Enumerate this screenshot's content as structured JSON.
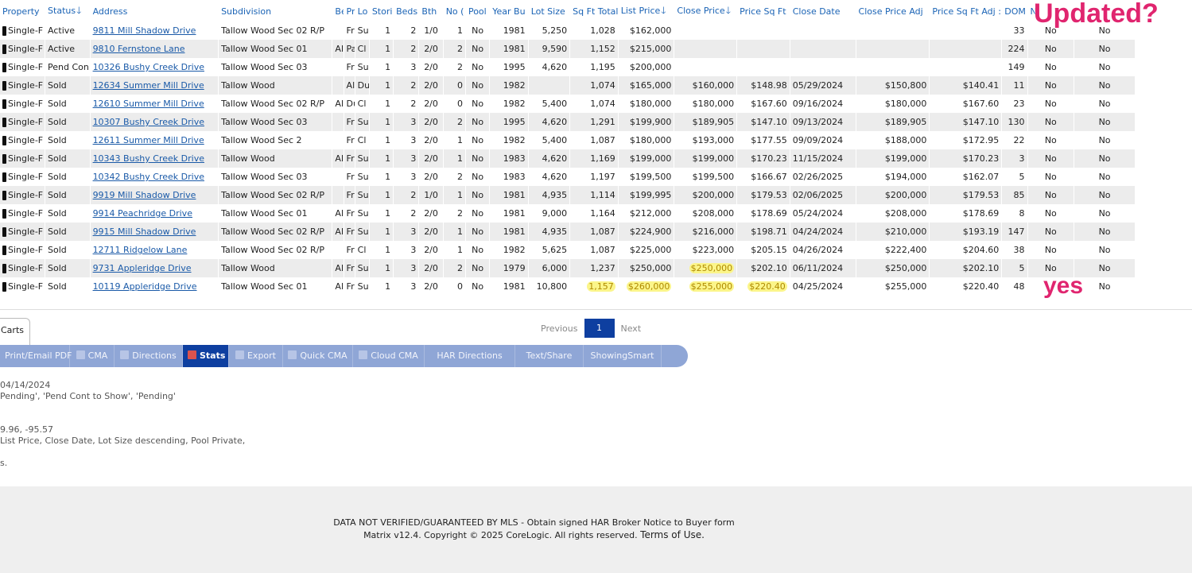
{
  "columns": [
    "Property",
    "Status",
    "Address",
    "Subdivision",
    "Be",
    "Pr",
    "Lo",
    "Stori",
    "Beds",
    "Bth",
    "No (",
    "Pool",
    "Year Bu",
    "Lot Size",
    "Sq Ft Total",
    "List Price",
    "Close Price",
    "Price Sq Ft",
    "Close Date",
    "Close Price Adj",
    "Price Sq Ft Adj :",
    "DOM",
    "N",
    ""
  ],
  "sort_arrows": {
    "status": "🡓",
    "list_price": "🡓",
    "close_price": "🡓"
  },
  "rows": [
    [
      "Single-F",
      "Active",
      "9811 Mill Shadow Drive",
      "Tallow Wood Sec 02 R/P",
      "",
      "Fr",
      "Su",
      "1",
      "2",
      "1/0",
      "1",
      "No",
      "1981",
      "5,250",
      "1,028",
      "$162,000",
      "",
      "",
      "",
      "",
      "",
      "33",
      "No",
      "No"
    ],
    [
      "Single-F",
      "Active",
      "9810 Fernstone Lane",
      "Tallow Wood Sec 01",
      "Al",
      "Pa",
      "Cl",
      "1",
      "2",
      "2/0",
      "2",
      "No",
      "1981",
      "9,590",
      "1,152",
      "$215,000",
      "",
      "",
      "",
      "",
      "",
      "224",
      "No",
      "No"
    ],
    [
      "Single-F",
      "Pend Con",
      "10326 Bushy Creek Drive",
      "Tallow Wood Sec 03",
      "",
      "Fr",
      "Su",
      "1",
      "3",
      "2/0",
      "2",
      "No",
      "1995",
      "4,620",
      "1,195",
      "$200,000",
      "",
      "",
      "",
      "",
      "",
      "149",
      "No",
      "No"
    ],
    [
      "Single-F",
      "Sold",
      "12634 Summer Mill Drive",
      "Tallow Wood",
      "",
      "Al",
      "Du",
      "1",
      "2",
      "2/0",
      "0",
      "No",
      "1982",
      "",
      "1,074",
      "$165,000",
      "$160,000",
      "$148.98",
      "05/29/2024",
      "$150,800",
      "$140.41",
      "11",
      "No",
      "No"
    ],
    [
      "Single-F",
      "Sold",
      "12610 Summer Mill Drive",
      "Tallow Wood Sec 02 R/P",
      "Al",
      "Du",
      "Cl",
      "1",
      "2",
      "2/0",
      "0",
      "No",
      "1982",
      "5,400",
      "1,074",
      "$180,000",
      "$180,000",
      "$167.60",
      "09/16/2024",
      "$180,000",
      "$167.60",
      "23",
      "No",
      "No"
    ],
    [
      "Single-F",
      "Sold",
      "10307 Bushy Creek Drive",
      "Tallow Wood Sec 03",
      "",
      "Fr",
      "Su",
      "1",
      "3",
      "2/0",
      "2",
      "No",
      "1995",
      "4,620",
      "1,291",
      "$199,900",
      "$189,905",
      "$147.10",
      "09/13/2024",
      "$189,905",
      "$147.10",
      "130",
      "No",
      "No"
    ],
    [
      "Single-F",
      "Sold",
      "12611 Summer Mill Drive",
      "Tallow Wood Sec 2",
      "",
      "Fr",
      "Cl",
      "1",
      "3",
      "2/0",
      "1",
      "No",
      "1982",
      "5,400",
      "1,087",
      "$180,000",
      "$193,000",
      "$177.55",
      "09/09/2024",
      "$188,000",
      "$172.95",
      "22",
      "No",
      "No"
    ],
    [
      "Single-F",
      "Sold",
      "10343 Bushy Creek Drive",
      "Tallow Wood",
      "Al",
      "Fr",
      "Su",
      "1",
      "3",
      "2/0",
      "1",
      "No",
      "1983",
      "4,620",
      "1,169",
      "$199,000",
      "$199,000",
      "$170.23",
      "11/15/2024",
      "$199,000",
      "$170.23",
      "3",
      "No",
      "No"
    ],
    [
      "Single-F",
      "Sold",
      "10342 Bushy Creek Drive",
      "Tallow Wood Sec 03",
      "",
      "Fr",
      "Su",
      "1",
      "3",
      "2/0",
      "2",
      "No",
      "1983",
      "4,620",
      "1,197",
      "$199,500",
      "$199,500",
      "$166.67",
      "02/26/2025",
      "$194,000",
      "$162.07",
      "5",
      "No",
      "No"
    ],
    [
      "Single-F",
      "Sold",
      "9919 Mill Shadow Drive",
      "Tallow Wood Sec 02 R/P",
      "",
      "Fr",
      "Su",
      "1",
      "2",
      "1/0",
      "1",
      "No",
      "1981",
      "4,935",
      "1,114",
      "$199,995",
      "$200,000",
      "$179.53",
      "02/06/2025",
      "$200,000",
      "$179.53",
      "85",
      "No",
      "No"
    ],
    [
      "Single-F",
      "Sold",
      "9914 Peachridge Drive",
      "Tallow Wood Sec 01",
      "Al",
      "Fr",
      "Su",
      "1",
      "2",
      "2/0",
      "2",
      "No",
      "1981",
      "9,000",
      "1,164",
      "$212,000",
      "$208,000",
      "$178.69",
      "05/24/2024",
      "$208,000",
      "$178.69",
      "8",
      "No",
      "No"
    ],
    [
      "Single-F",
      "Sold",
      "9915 Mill Shadow Drive",
      "Tallow Wood Sec 02 R/P",
      "Al",
      "Fr",
      "Su",
      "1",
      "3",
      "2/0",
      "1",
      "No",
      "1981",
      "4,935",
      "1,087",
      "$224,900",
      "$216,000",
      "$198.71",
      "04/24/2024",
      "$210,000",
      "$193.19",
      "147",
      "No",
      "No"
    ],
    [
      "Single-F",
      "Sold",
      "12711 Ridgelow Lane",
      "Tallow Wood Sec 02 R/P",
      "",
      "Fr",
      "Cl",
      "1",
      "3",
      "2/0",
      "1",
      "No",
      "1982",
      "5,625",
      "1,087",
      "$225,000",
      "$223,000",
      "$205.15",
      "04/26/2024",
      "$222,400",
      "$204.60",
      "38",
      "No",
      "No"
    ],
    [
      "Single-F",
      "Sold",
      "9731 Appleridge Drive",
      "Tallow Wood",
      "",
      "Al",
      "Fr",
      "Su",
      "1",
      "3",
      "2/0",
      "2",
      "No",
      "1979",
      "6,000",
      "1,237",
      "$250,000",
      "$250,000",
      "$202.10",
      "06/11/2024",
      "$250,000",
      "$202.10",
      "5",
      "No",
      "No"
    ],
    [
      "Single-F",
      "Sold",
      "10119 Appleridge Drive",
      "Tallow Wood Sec 01",
      "",
      "Al",
      "Fr",
      "Su",
      "1",
      "3",
      "2/0",
      "0",
      "No",
      "1981",
      "10,800",
      "1,157",
      "$260,000",
      "$255,000",
      "$220.40",
      "04/25/2024",
      "$255,000",
      "$220.40",
      "48",
      "",
      "No"
    ]
  ],
  "annotations": {
    "updated": "Updated?",
    "yes": "yes"
  },
  "tabs": {
    "carts": "Carts"
  },
  "pager": {
    "prev": "Previous",
    "current": "1",
    "next": "Next"
  },
  "toolbar": [
    "Print/Email PDF",
    "CMA",
    "Directions",
    "Stats",
    "Export",
    "Quick CMA",
    "Cloud CMA",
    "HAR Directions",
    "Text/Share",
    "ShowingSmart"
  ],
  "toolbar_active": "Stats",
  "notes": [
    "04/14/2024",
    "Pending', 'Pend Cont to Show', 'Pending'",
    "",
    "",
    "9.96, -95.57",
    "List Price, Close Date, Lot Size descending, Pool Private,",
    "",
    "s."
  ],
  "footer": {
    "line1": "DATA NOT VERIFIED/GUARANTEED BY MLS - Obtain signed HAR Broker Notice to Buyer form",
    "line2": "Matrix v12.4. Copyright © 2025 CoreLogic. All rights reserved.",
    "terms": "Terms of Use."
  },
  "colors": {
    "link": "#1a5aa8",
    "header": "#1a63b5",
    "active_tab": "#0e3fa0",
    "toolbar": "#8fa6d6",
    "highlight": "#fbf58a",
    "annotation": "#e0256f"
  }
}
